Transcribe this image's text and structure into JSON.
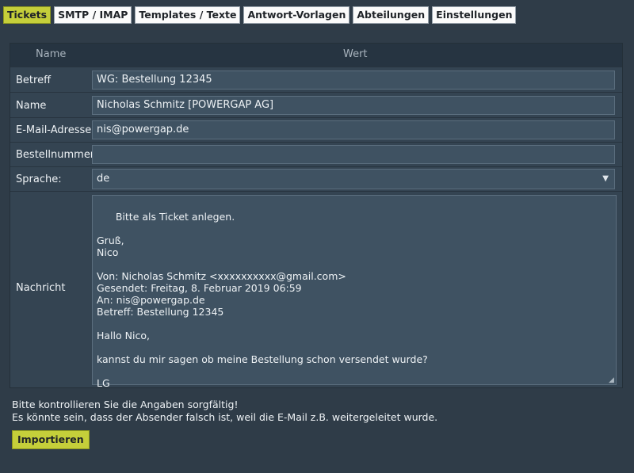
{
  "tabs": [
    "Tickets",
    "SMTP / IMAP",
    "Templates / Texte",
    "Antwort-Vorlagen",
    "Abteilungen",
    "Einstellungen"
  ],
  "table": {
    "col_name": "Name",
    "col_value": "Wert"
  },
  "fields": {
    "subject": {
      "label": "Betreff",
      "value": "WG: Bestellung 12345"
    },
    "name": {
      "label": "Name",
      "value": "Nicholas Schmitz [POWERGAP AG]"
    },
    "email": {
      "label": "E-Mail-Adresse",
      "value": "nis@powergap.de"
    },
    "order": {
      "label": "Bestellnummer",
      "value": ""
    },
    "language": {
      "label": "Sprache:",
      "value": "de"
    },
    "message": {
      "label": "Nachricht",
      "value": "Bitte als Ticket anlegen.\n\nGruß,\nNico\n\nVon: Nicholas Schmitz <xxxxxxxxxx@gmail.com>\nGesendet: Freitag, 8. Februar 2019 06:59\nAn: nis@powergap.de\nBetreff: Bestellung 12345\n\nHallo Nico,\n\nkannst du mir sagen ob meine Bestellung schon versendet wurde?\n\nLG"
    }
  },
  "notice": {
    "line1": "Bitte kontrollieren Sie die Angaben sorgfältig!",
    "line2": "Es könnte sein, dass der Absender falsch ist, weil die E-Mail z.B. weitergeleitet wurde."
  },
  "import_button": "Importieren",
  "icons": {
    "select_arrow": "chevron-down-icon",
    "resize": "resize-grip-icon"
  }
}
